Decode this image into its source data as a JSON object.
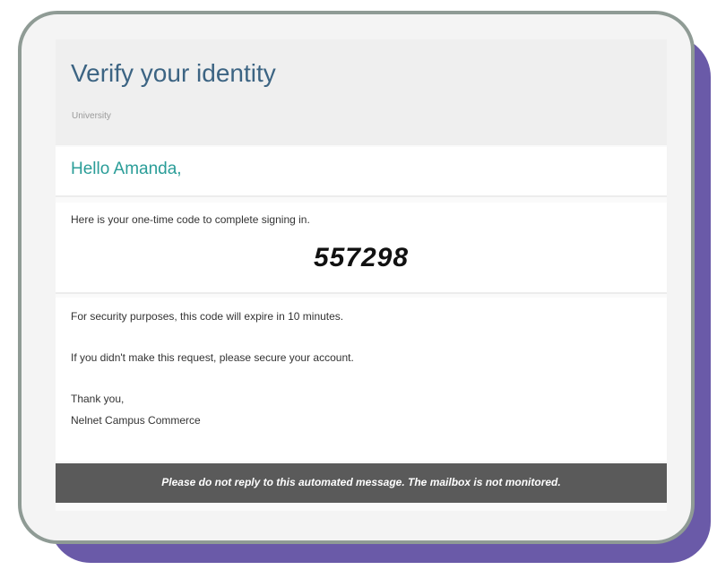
{
  "email": {
    "title": "Verify your identity",
    "subtitle": "University",
    "greeting": "Hello Amanda,",
    "intro": "Here is your one-time code to complete signing in.",
    "code": "557298",
    "expiry_notice": "For security purposes, this code will expire in 10 minutes.",
    "security_notice": "If you didn't make this request, please secure your account.",
    "signoff": "Thank you,",
    "sender": "Nelnet Campus Commerce",
    "footer": "Please do not reply to this automated message. The mailbox is not monitored."
  },
  "colors": {
    "title": "#3c6483",
    "greeting": "#2a9d98",
    "footer_bg": "#5a5a5a",
    "shadow": "#6a5aa8",
    "frame_border": "#8f9b95"
  }
}
